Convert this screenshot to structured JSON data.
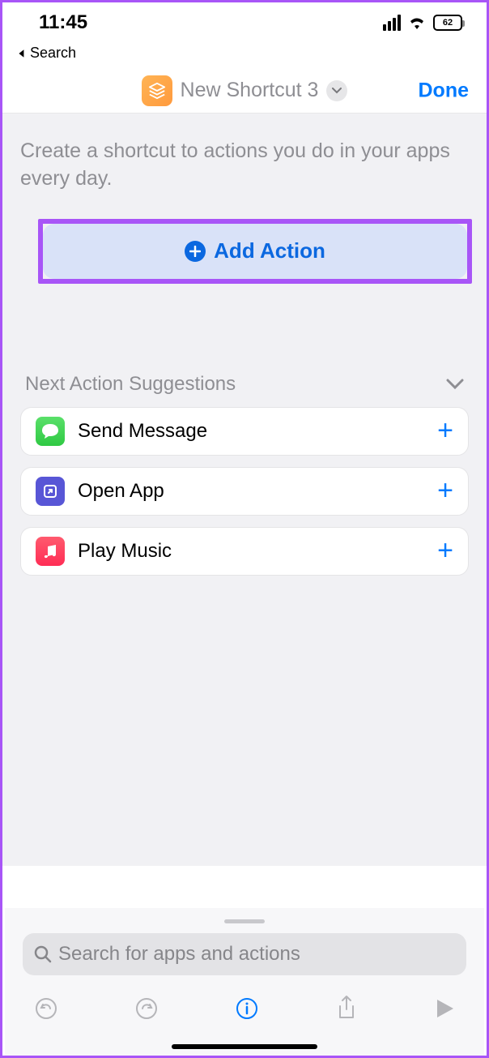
{
  "status": {
    "time": "11:45",
    "battery": "62"
  },
  "back": {
    "label": "Search"
  },
  "header": {
    "title": "New Shortcut 3",
    "done": "Done"
  },
  "intro": "Create a shortcut to actions you do in your apps every day.",
  "add_action": "Add Action",
  "suggestions": {
    "title": "Next Action Suggestions",
    "items": [
      {
        "label": "Send Message",
        "icon": "messages"
      },
      {
        "label": "Open App",
        "icon": "shortcuts"
      },
      {
        "label": "Play Music",
        "icon": "music"
      }
    ]
  },
  "search": {
    "placeholder": "Search for apps and actions"
  }
}
